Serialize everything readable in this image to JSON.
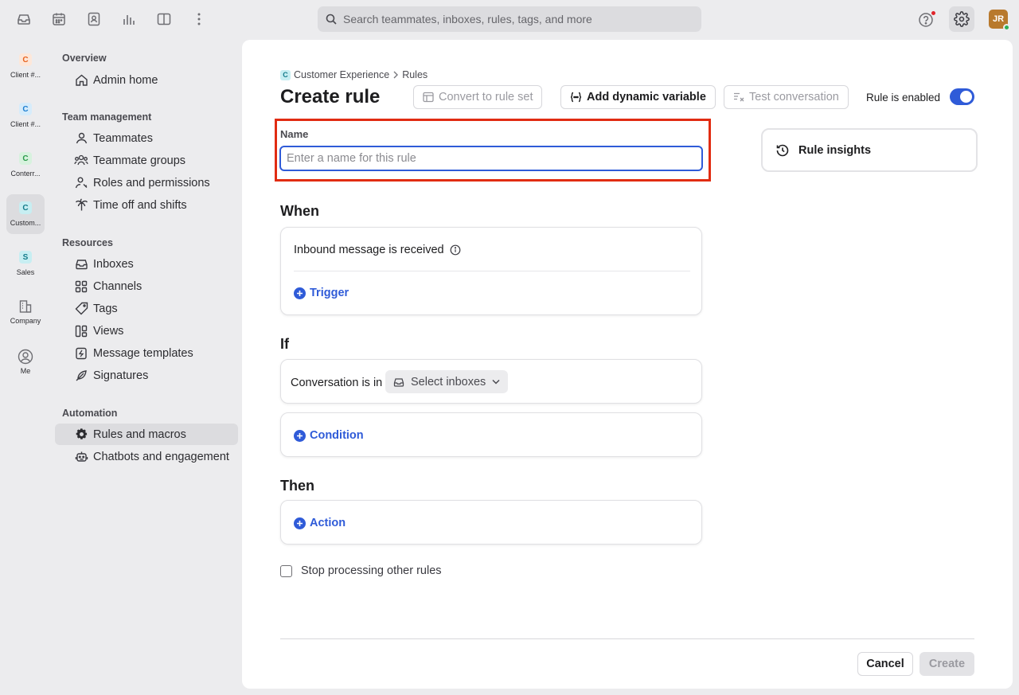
{
  "topbar": {
    "icons": [
      "inbox-icon",
      "calendar-icon",
      "contacts-icon",
      "analytics-icon",
      "split-view-icon",
      "more-icon"
    ],
    "search_placeholder": "Search teammates, inboxes, rules, tags, and more",
    "avatar_initials": "JR"
  },
  "workspaces": [
    {
      "badge": "C",
      "label": "Client #...",
      "color": "#e8621e",
      "bg": "#fde7d9"
    },
    {
      "badge": "C",
      "label": "Client #...",
      "color": "#1d7fd1",
      "bg": "#d6ecfb"
    },
    {
      "badge": "C",
      "label": "Conterr...",
      "color": "#2a9a4a",
      "bg": "#d7f2de"
    },
    {
      "badge": "C",
      "label": "Custom...",
      "color": "#137b8a",
      "bg": "#c7eef2"
    },
    {
      "badge": "S",
      "label": "Sales",
      "color": "#137b8a",
      "bg": "#c7eef2"
    },
    {
      "icon": "building-icon",
      "label": "Company"
    },
    {
      "icon": "user-circle-icon",
      "label": "Me"
    }
  ],
  "nav": {
    "overview_heading": "Overview",
    "admin_home": "Admin home",
    "team_heading": "Team management",
    "teammates": "Teammates",
    "teammate_groups": "Teammate groups",
    "roles_permissions": "Roles and permissions",
    "time_off": "Time off and shifts",
    "resources_heading": "Resources",
    "inboxes": "Inboxes",
    "channels": "Channels",
    "tags": "Tags",
    "views": "Views",
    "message_templates": "Message templates",
    "signatures": "Signatures",
    "automation_heading": "Automation",
    "rules_macros": "Rules and macros",
    "chatbots": "Chatbots and engagement"
  },
  "main": {
    "breadcrumb_workspace": "Customer Experience",
    "breadcrumb_workspace_badge": "C",
    "breadcrumb_page": "Rules",
    "title": "Create rule",
    "convert_btn": "Convert to rule set",
    "dynamic_var_btn": "Add dynamic variable",
    "test_btn": "Test conversation",
    "rule_enabled_label": "Rule is enabled",
    "rule_enabled": true,
    "name_label": "Name",
    "name_placeholder": "Enter a name for this rule",
    "name_value": "",
    "insights_label": "Rule insights",
    "when_title": "When",
    "when_trigger_text": "Inbound message is received",
    "trigger_link": "Trigger",
    "if_title": "If",
    "conversation_is_in": "Conversation is in",
    "select_inboxes": "Select inboxes",
    "condition_link": "Condition",
    "then_title": "Then",
    "action_link": "Action",
    "stop_processing_label": "Stop processing other rules",
    "stop_processing_checked": false,
    "cancel_btn": "Cancel",
    "create_btn": "Create"
  },
  "colors": {
    "accent": "#2f5bd8",
    "highlight_box": "#e12c12",
    "avatar": "#b8792d"
  }
}
